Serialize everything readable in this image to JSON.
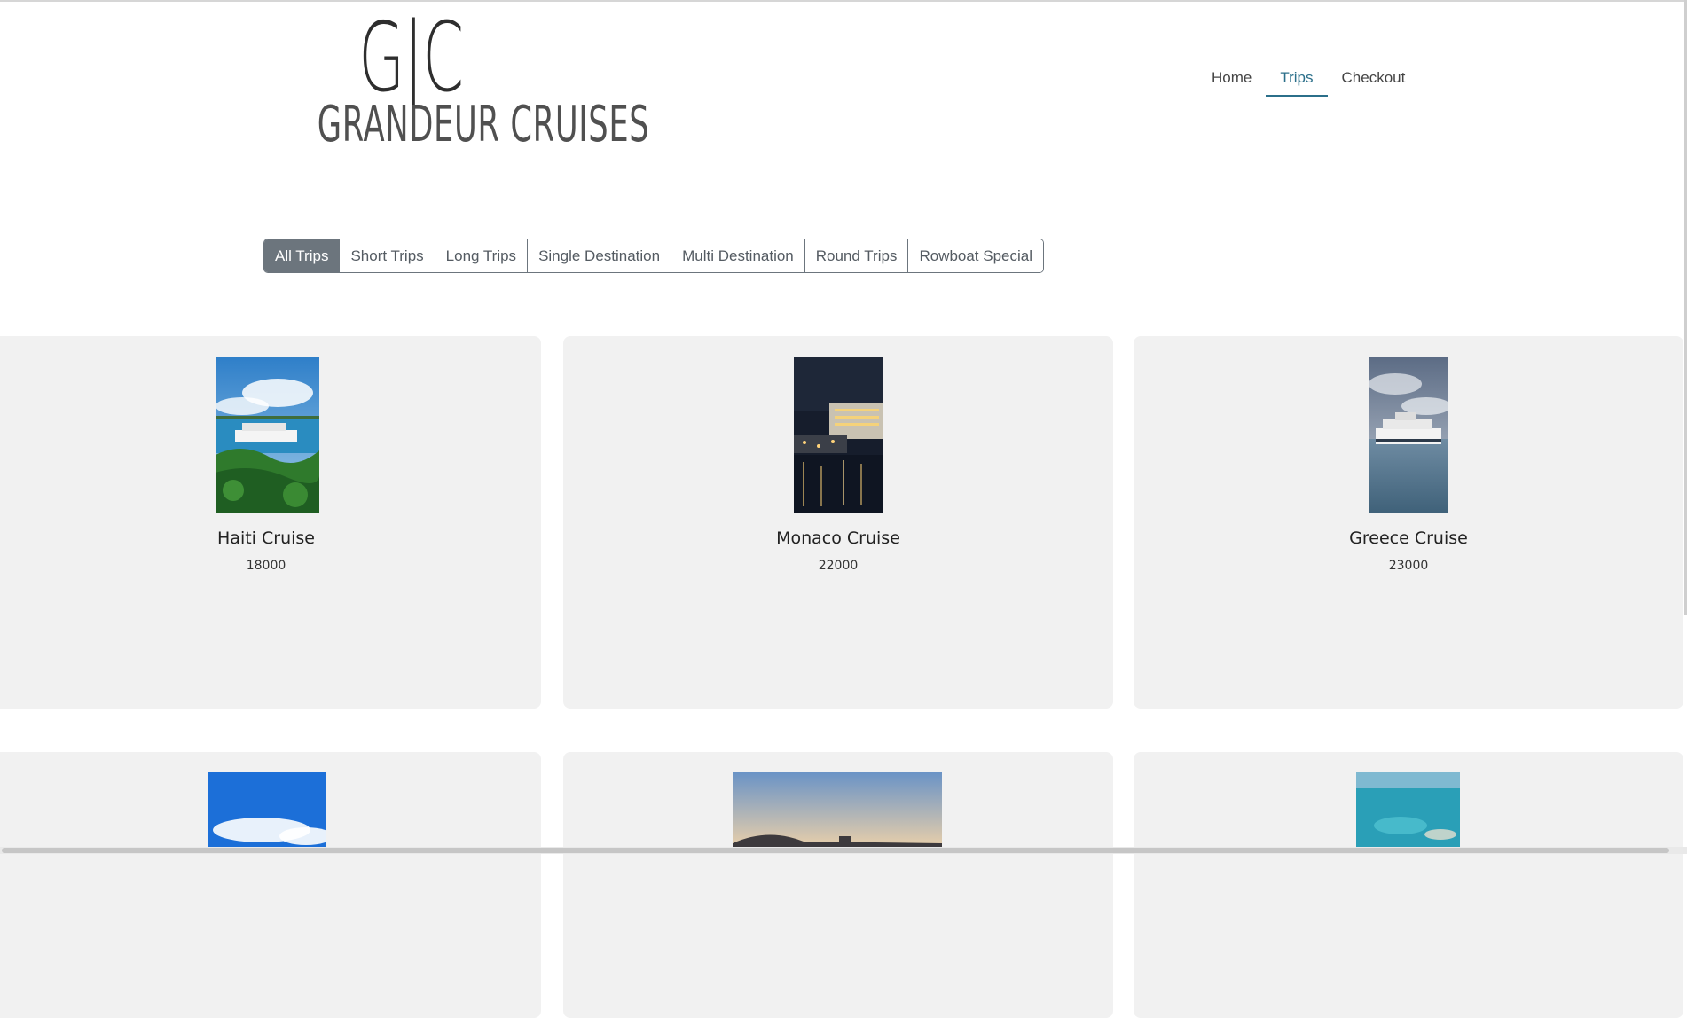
{
  "brand": {
    "mark": "G|C",
    "name": "GRANDEUR CRUISES"
  },
  "nav": {
    "items": [
      {
        "label": "Home",
        "active": false
      },
      {
        "label": "Trips",
        "active": true
      },
      {
        "label": "Checkout",
        "active": false
      }
    ]
  },
  "filters": {
    "items": [
      {
        "label": "All Trips",
        "active": true
      },
      {
        "label": "Short Trips",
        "active": false
      },
      {
        "label": "Long Trips",
        "active": false
      },
      {
        "label": "Single Destination",
        "active": false
      },
      {
        "label": "Multi Destination",
        "active": false
      },
      {
        "label": "Round Trips",
        "active": false
      },
      {
        "label": "Rowboat Special",
        "active": false
      }
    ]
  },
  "trips": [
    {
      "name": "Haiti Cruise",
      "price": "18000",
      "image": "cruise-ship-green-hillside-icon"
    },
    {
      "name": "Monaco Cruise",
      "price": "22000",
      "image": "cruise-ship-night-lights-icon"
    },
    {
      "name": "Greece Cruise",
      "price": "23000",
      "image": "cruise-ship-cloudy-sea-icon"
    },
    {
      "name": "",
      "price": "",
      "image": "blue-sky-clouds-icon"
    },
    {
      "name": "",
      "price": "",
      "image": "sunset-harbor-icon"
    },
    {
      "name": "",
      "price": "",
      "image": "turquoise-water-aerial-icon"
    }
  ],
  "colors": {
    "accent": "#2b6f8a",
    "filter_active": "#6c757d",
    "card_bg": "#f1f1f1"
  }
}
